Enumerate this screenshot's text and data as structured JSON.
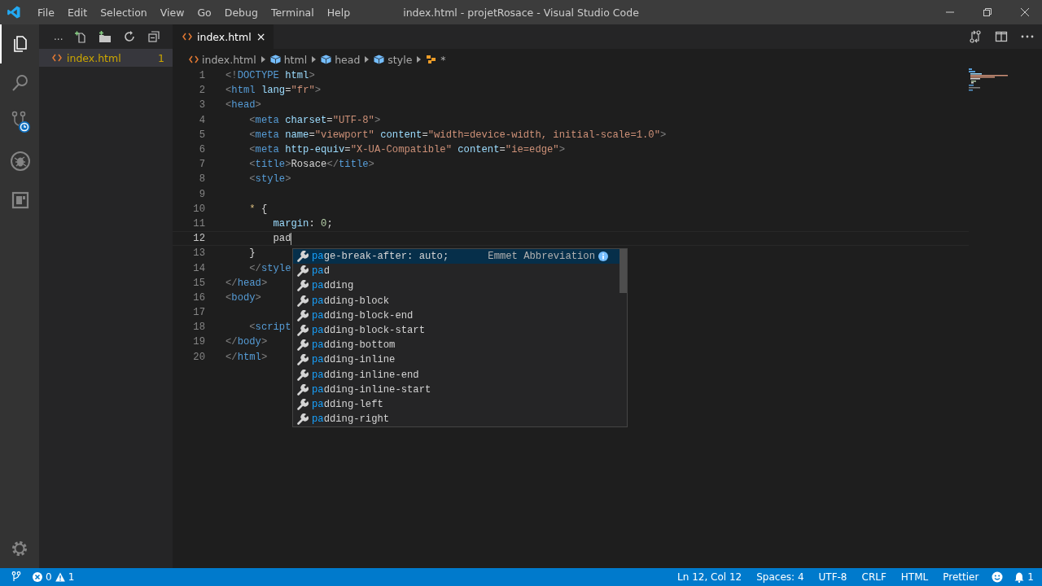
{
  "window": {
    "title": "index.html - projetRosace - Visual Studio Code"
  },
  "menu": [
    "File",
    "Edit",
    "Selection",
    "View",
    "Go",
    "Debug",
    "Terminal",
    "Help"
  ],
  "activity_bar": [
    {
      "kind": "files",
      "selected": true
    },
    {
      "kind": "search",
      "selected": false
    },
    {
      "kind": "source-control",
      "selected": false
    },
    {
      "kind": "debug",
      "selected": false
    },
    {
      "kind": "extensions",
      "selected": false
    }
  ],
  "explorer": {
    "toolbar_more": "...",
    "files": [
      {
        "name": "index.html",
        "badge": "1",
        "selected": true
      }
    ]
  },
  "tabs": [
    {
      "label": "index.html",
      "close": "×",
      "selected": true
    }
  ],
  "breadcrumbs": [
    {
      "label": "index.html",
      "kind": "file"
    },
    {
      "label": "html",
      "kind": "element"
    },
    {
      "label": "head",
      "kind": "element"
    },
    {
      "label": "style",
      "kind": "element"
    },
    {
      "label": "*",
      "kind": "rule"
    }
  ],
  "editor": {
    "lines": [
      {
        "number": "1",
        "tokens": [
          {
            "text": "<!",
            "kind": "p"
          },
          {
            "text": "DOCTYPE ",
            "kind": "tag"
          },
          {
            "text": "html",
            "kind": "attr"
          },
          {
            "text": ">",
            "kind": "p"
          }
        ]
      },
      {
        "number": "2",
        "tokens": [
          {
            "text": "<",
            "kind": "p"
          },
          {
            "text": "html ",
            "kind": "tag"
          },
          {
            "text": "lang",
            "kind": "attr"
          },
          {
            "text": "=",
            "kind": "t"
          },
          {
            "text": "\"fr\"",
            "kind": "str"
          },
          {
            "text": ">",
            "kind": "p"
          }
        ]
      },
      {
        "number": "3",
        "tokens": [
          {
            "text": "<",
            "kind": "p"
          },
          {
            "text": "head",
            "kind": "tag"
          },
          {
            "text": ">",
            "kind": "p"
          }
        ]
      },
      {
        "number": "4",
        "tokens": [
          {
            "text": "    <",
            "kind": "p"
          },
          {
            "text": "meta ",
            "kind": "tag"
          },
          {
            "text": "charset",
            "kind": "attr"
          },
          {
            "text": "=",
            "kind": "t"
          },
          {
            "text": "\"UTF-8\"",
            "kind": "str"
          },
          {
            "text": ">",
            "kind": "p"
          }
        ]
      },
      {
        "number": "5",
        "tokens": [
          {
            "text": "    <",
            "kind": "p"
          },
          {
            "text": "meta ",
            "kind": "tag"
          },
          {
            "text": "name",
            "kind": "attr"
          },
          {
            "text": "=",
            "kind": "t"
          },
          {
            "text": "\"viewport\" ",
            "kind": "str"
          },
          {
            "text": "content",
            "kind": "attr"
          },
          {
            "text": "=",
            "kind": "t"
          },
          {
            "text": "\"width=device-width, initial-scale=1.0\"",
            "kind": "str"
          },
          {
            "text": ">",
            "kind": "p"
          }
        ]
      },
      {
        "number": "6",
        "tokens": [
          {
            "text": "    <",
            "kind": "p"
          },
          {
            "text": "meta ",
            "kind": "tag"
          },
          {
            "text": "http-equiv",
            "kind": "attr"
          },
          {
            "text": "=",
            "kind": "t"
          },
          {
            "text": "\"X-UA-Compatible\" ",
            "kind": "str"
          },
          {
            "text": "content",
            "kind": "attr"
          },
          {
            "text": "=",
            "kind": "t"
          },
          {
            "text": "\"ie=edge\"",
            "kind": "str"
          },
          {
            "text": ">",
            "kind": "p"
          }
        ]
      },
      {
        "number": "7",
        "tokens": [
          {
            "text": "    <",
            "kind": "p"
          },
          {
            "text": "title",
            "kind": "tag"
          },
          {
            "text": ">",
            "kind": "p"
          },
          {
            "text": "Rosace",
            "kind": "t"
          },
          {
            "text": "</",
            "kind": "p"
          },
          {
            "text": "title",
            "kind": "tag"
          },
          {
            "text": ">",
            "kind": "p"
          }
        ]
      },
      {
        "number": "8",
        "tokens": [
          {
            "text": "    <",
            "kind": "p"
          },
          {
            "text": "style",
            "kind": "tag"
          },
          {
            "text": ">",
            "kind": "p"
          }
        ]
      },
      {
        "number": "9"
      },
      {
        "number": "10",
        "tokens": [
          {
            "text": "    *",
            "kind": "sel"
          },
          {
            "text": " {",
            "kind": "t"
          }
        ]
      },
      {
        "number": "11",
        "tokens": [
          {
            "text": "        margin",
            "kind": "prop"
          },
          {
            "text": ": ",
            "kind": "t"
          },
          {
            "text": "0",
            "kind": "num"
          },
          {
            "text": ";",
            "kind": "t"
          }
        ]
      },
      {
        "number": "12",
        "current": true,
        "tokens": [
          {
            "text": "        pad",
            "kind": "t"
          }
        ]
      },
      {
        "number": "13",
        "tokens": [
          {
            "text": "    }",
            "kind": "t"
          }
        ]
      },
      {
        "number": "14",
        "tokens": [
          {
            "text": "    </",
            "kind": "p"
          },
          {
            "text": "style",
            "kind": "tag"
          }
        ]
      },
      {
        "number": "15",
        "tokens": [
          {
            "text": "</",
            "kind": "p"
          },
          {
            "text": "head",
            "kind": "tag"
          },
          {
            "text": ">",
            "kind": "p"
          }
        ]
      },
      {
        "number": "16",
        "tokens": [
          {
            "text": "<",
            "kind": "p"
          },
          {
            "text": "body",
            "kind": "tag"
          },
          {
            "text": ">",
            "kind": "p"
          }
        ]
      },
      {
        "number": "17"
      },
      {
        "number": "18",
        "tokens": [
          {
            "text": "    <",
            "kind": "p"
          },
          {
            "text": "script",
            "kind": "tag"
          }
        ]
      },
      {
        "number": "19",
        "tokens": [
          {
            "text": "</",
            "kind": "p"
          },
          {
            "text": "body",
            "kind": "tag"
          },
          {
            "text": ">",
            "kind": "p"
          }
        ]
      },
      {
        "number": "20",
        "tokens": [
          {
            "text": "</",
            "kind": "p"
          },
          {
            "text": "html",
            "kind": "tag"
          },
          {
            "text": ">",
            "kind": "p"
          }
        ]
      }
    ]
  },
  "suggestions": [
    {
      "match": "pa",
      "rest": "ge-break-after: auto;",
      "detail": "Emmet Abbreviation",
      "selected": true
    },
    {
      "match": "pa",
      "rest": "d",
      "selected": false
    },
    {
      "match": "pa",
      "rest": "dding",
      "selected": false
    },
    {
      "match": "pa",
      "rest": "dding-block",
      "selected": false
    },
    {
      "match": "pa",
      "rest": "dding-block-end",
      "selected": false
    },
    {
      "match": "pa",
      "rest": "dding-block-start",
      "selected": false
    },
    {
      "match": "pa",
      "rest": "dding-bottom",
      "selected": false
    },
    {
      "match": "pa",
      "rest": "dding-inline",
      "selected": false
    },
    {
      "match": "pa",
      "rest": "dding-inline-end",
      "selected": false
    },
    {
      "match": "pa",
      "rest": "dding-inline-start",
      "selected": false
    },
    {
      "match": "pa",
      "rest": "dding-left",
      "selected": false
    },
    {
      "match": "pa",
      "rest": "dding-right",
      "selected": false
    }
  ],
  "status_bar": {
    "errors": "0",
    "warnings": "1",
    "right": [
      "Ln 12, Col 12",
      "Spaces: 4",
      "UTF-8",
      "CRLF",
      "HTML",
      "Prettier"
    ],
    "notifications": "1"
  }
}
